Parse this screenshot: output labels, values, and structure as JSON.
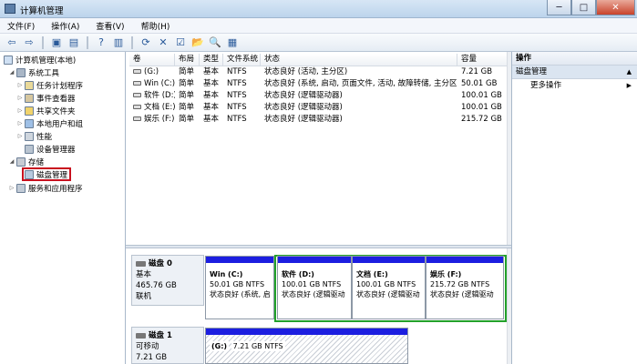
{
  "window": {
    "title": "计算机管理",
    "buttons": {
      "min": "─",
      "max": "□",
      "close": "✕"
    }
  },
  "menu": [
    "文件(F)",
    "操作(A)",
    "查看(V)",
    "帮助(H)"
  ],
  "toolbar": {
    "icons": [
      "back-icon",
      "forward-icon",
      "up-folder-icon",
      "show-tree-icon",
      "help-icon",
      "console-icon",
      "refresh-icon",
      "delete-icon",
      "properties-icon",
      "open-folder-icon",
      "search-icon",
      "export-icon"
    ],
    "glyphs": [
      "⇦",
      "⇨",
      "▣",
      "▤",
      "?",
      "▥",
      "⟳",
      "✕",
      "☑",
      "📂",
      "🔍",
      "▦"
    ]
  },
  "tree": {
    "root": "计算机管理(本地)",
    "system_tools": "系统工具",
    "task_scheduler": "任务计划程序",
    "event_viewer": "事件查看器",
    "shared_folders": "共享文件夹",
    "local_users": "本地用户和组",
    "performance": "性能",
    "device_manager": "设备管理器",
    "storage": "存储",
    "disk_management": "磁盘管理",
    "services": "服务和应用程序"
  },
  "volumes": {
    "headers": [
      "卷",
      "布局",
      "类型",
      "文件系统",
      "状态",
      "容量"
    ],
    "rows": [
      [
        "(G:)",
        "简单",
        "基本",
        "NTFS",
        "状态良好 (活动, 主分区)",
        "7.21 GB"
      ],
      [
        "Win (C:)",
        "简单",
        "基本",
        "NTFS",
        "状态良好 (系统, 启动, 页面文件, 活动, 故障转储, 主分区",
        "50.01 GB"
      ],
      [
        "软件 (D:)",
        "简单",
        "基本",
        "NTFS",
        "状态良好 (逻辑驱动器)",
        "100.01 GB"
      ],
      [
        "文档 (E:)",
        "简单",
        "基本",
        "NTFS",
        "状态良好 (逻辑驱动器)",
        "100.01 GB"
      ],
      [
        "娱乐 (F:)",
        "简单",
        "基本",
        "NTFS",
        "状态良好 (逻辑驱动器)",
        "215.72 GB"
      ]
    ]
  },
  "disk0": {
    "label": "磁盘 0",
    "type": "基本",
    "size": "465.76 GB",
    "status": "联机",
    "partitions": [
      {
        "name": "Win  (C:)",
        "size": "50.01 GB NTFS",
        "status": "状态良好 (系统, 启"
      },
      {
        "name": "软件  (D:)",
        "size": "100.01 GB NTFS",
        "status": "状态良好 (逻辑驱动"
      },
      {
        "name": "文档  (E:)",
        "size": "100.01 GB NTFS",
        "status": "状态良好 (逻辑驱动"
      },
      {
        "name": "娱乐  (F:)",
        "size": "215.72 GB NTFS",
        "status": "状态良好 (逻辑驱动"
      }
    ]
  },
  "disk1": {
    "label": "磁盘 1",
    "type": "可移动",
    "size": "7.21 GB",
    "partitions": [
      {
        "name": "(G:)",
        "size": "7.21 GB NTFS"
      }
    ]
  },
  "actions": {
    "header": "操作",
    "section": "磁盘管理",
    "more": "更多操作",
    "arrow_up": "▲",
    "arrow_right": "▶"
  },
  "colors": {
    "partition_bar": "#1c1ee0",
    "extended_border": "#22a12a",
    "selection_box": "#c8101e"
  }
}
